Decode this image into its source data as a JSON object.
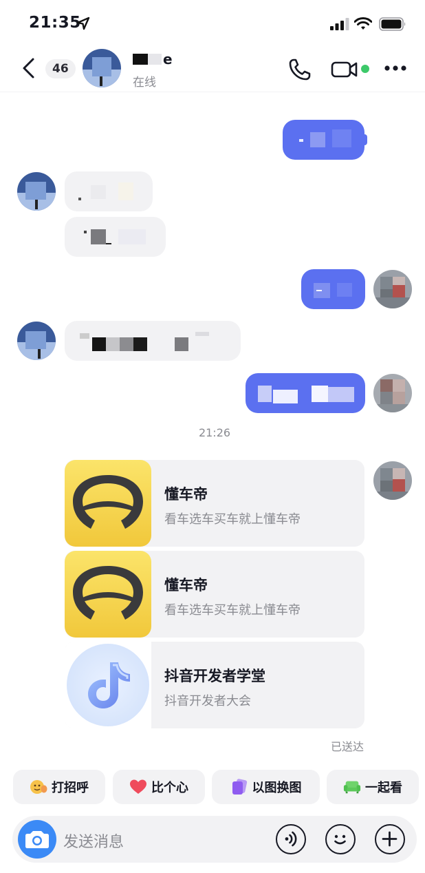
{
  "status_bar": {
    "time": "21:35"
  },
  "header": {
    "unread_count": "46",
    "contact_name_suffix": "e",
    "contact_status": "在线"
  },
  "chat": {
    "timestamp": "21:26",
    "shared_cards": [
      {
        "title": "懂车帝",
        "subtitle": "看车选车买车就上懂车帝",
        "icon": "dongchedi-steering-wheel-icon",
        "icon_color": "#f7d640"
      },
      {
        "title": "懂车帝",
        "subtitle": "看车选车买车就上懂车帝",
        "icon": "dongchedi-steering-wheel-icon",
        "icon_color": "#f7d640"
      },
      {
        "title": "抖音开发者学堂",
        "subtitle": "抖音开发者大会",
        "icon": "douyin-note-icon",
        "icon_color": "#7aa6f5"
      }
    ],
    "delivery_status": "已送达"
  },
  "quick_actions": [
    {
      "label": "打招呼",
      "icon": "wave-emoji-icon"
    },
    {
      "label": "比个心",
      "icon": "heart-icon"
    },
    {
      "label": "以图换图",
      "icon": "cards-icon"
    },
    {
      "label": "一起看",
      "icon": "sofa-icon"
    }
  ],
  "composer": {
    "placeholder": "发送消息",
    "icons": [
      "camera-icon",
      "voice-icon",
      "emoji-icon",
      "plus-icon"
    ]
  },
  "colors": {
    "outgoing_bubble": "#5b70f0",
    "incoming_bubble": "#f2f2f4",
    "online_dot": "#3dc96a",
    "camera_button": "#3b8af6"
  }
}
